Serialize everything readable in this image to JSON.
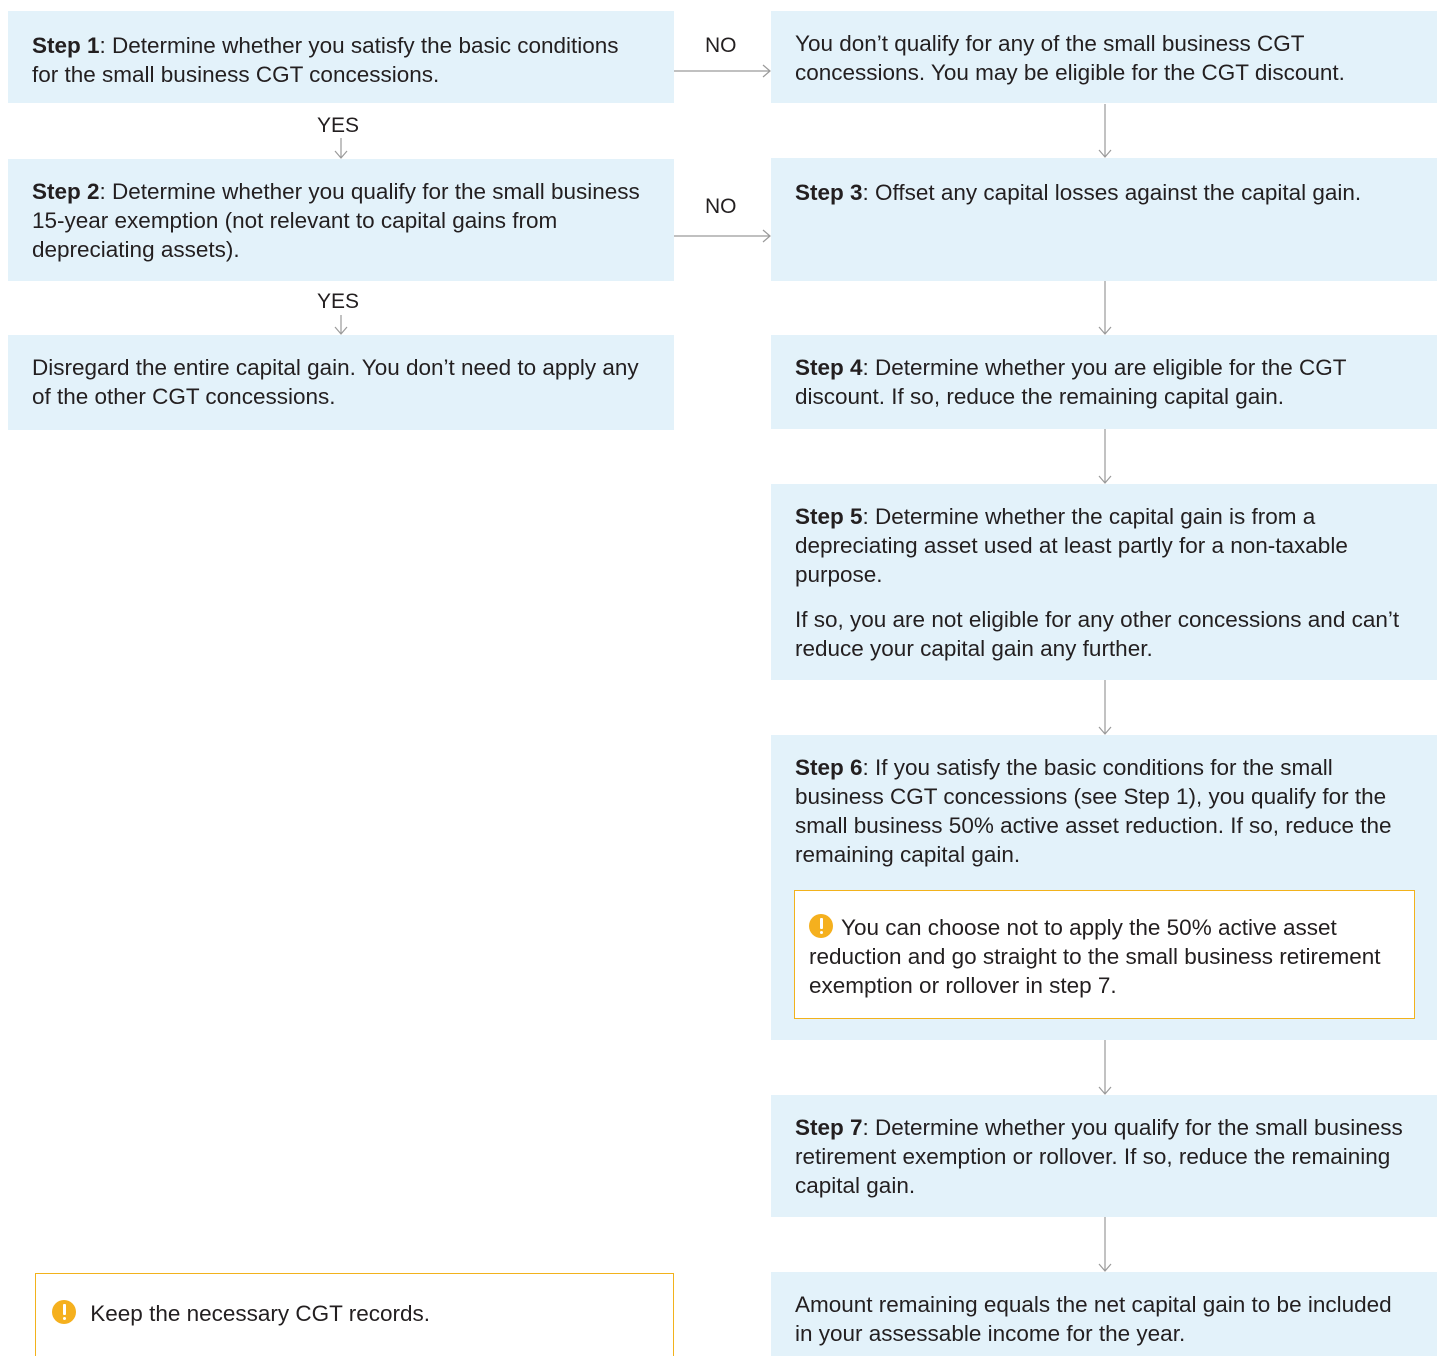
{
  "labels": {
    "no": "NO",
    "yes": "YES"
  },
  "step1": {
    "title": "Step 1",
    "text": ": Determine whether you satisfy the basic conditions for the small business CGT concessions."
  },
  "no_qualify": {
    "text": "You don’t qualify for any of the small business CGT concessions. You may be eligible for the CGT discount."
  },
  "step2": {
    "title": "Step 2",
    "text": ": Determine whether you qualify for the small business 15-year exemption (not relevant to capital gains from depreciating assets)."
  },
  "step3": {
    "title": "Step 3",
    "text": ": Offset any capital losses against the capital gain."
  },
  "disregard": {
    "text": "Disregard the entire capital gain. You don’t need to apply any of the other CGT concessions."
  },
  "step4": {
    "title": "Step 4",
    "text": ": Determine whether you are eligible for the CGT discount. If so, reduce the remaining capital gain."
  },
  "step5": {
    "title": "Step 5",
    "text": ": Determine whether the capital gain is from a depreciating asset used at least partly for a non-taxable purpose.",
    "text2": "If so, you are not eligible for any other concessions and can’t reduce your capital gain any further."
  },
  "step6": {
    "title": "Step 6",
    "text": ": If you satisfy the basic conditions for the small business CGT concessions (see Step 1), you qualify for the small business 50% active asset reduction. If so, reduce the remaining capital gain.",
    "note": "You can choose not to apply the 50% active asset reduction and go straight to the small business retirement exemption or rollover in step 7."
  },
  "step7": {
    "title": "Step 7",
    "text": ": Determine whether you qualify for the small business retirement exemption or rollover. If so, reduce the remaining capital gain."
  },
  "final": {
    "text": "Amount remaining equals the net capital gain to be included in your assessable income for the year."
  },
  "records_note": {
    "text": "Keep the necessary CGT records."
  },
  "colors": {
    "box_fill": "#e3f2fa",
    "note_border": "#f2b21c",
    "warning_icon": "#f5b01e",
    "arrow": "#9a9a9a"
  }
}
